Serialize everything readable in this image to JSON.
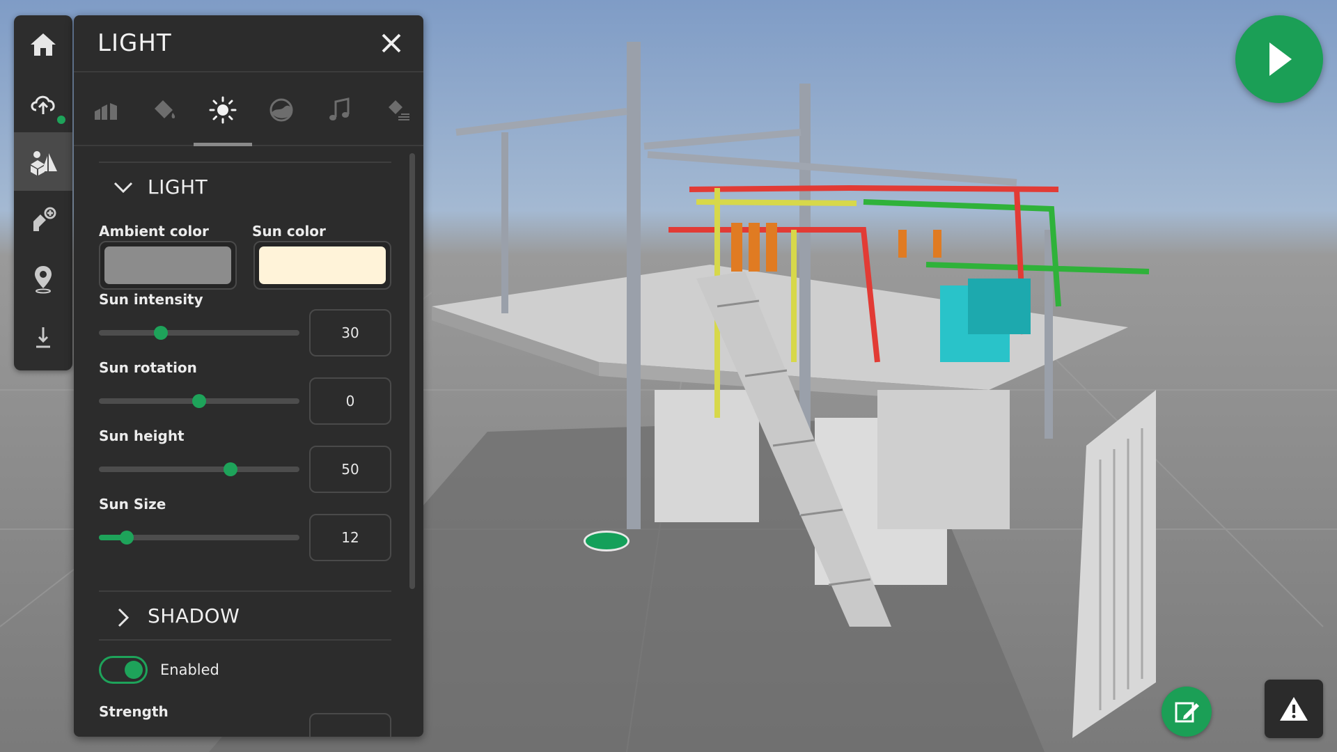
{
  "panel": {
    "title": "LIGHT",
    "tabs": [
      {
        "icon": "buildings-icon"
      },
      {
        "icon": "paint-bucket-icon"
      },
      {
        "icon": "sun-icon",
        "active": true
      },
      {
        "icon": "environment-globe-icon"
      },
      {
        "icon": "music-note-icon"
      },
      {
        "icon": "paint-layers-icon"
      }
    ],
    "light_section": {
      "title": "LIGHT",
      "ambient_color_label": "Ambient color",
      "ambient_color": "#8c8c8c",
      "sun_color_label": "Sun color",
      "sun_color": "#fff3d9",
      "sun_intensity": {
        "label": "Sun intensity",
        "value": "30",
        "fraction": 0.31
      },
      "sun_rotation": {
        "label": "Sun rotation",
        "value": "0",
        "fraction": 0.5
      },
      "sun_height": {
        "label": "Sun height",
        "value": "50",
        "fraction": 0.655
      },
      "sun_size": {
        "label": "Sun Size",
        "value": "12",
        "fraction": 0.14
      }
    },
    "shadow_section": {
      "title": "SHADOW",
      "enabled_label": "Enabled",
      "enabled": true,
      "strength_label": "Strength"
    }
  },
  "toolbar": {
    "items": [
      {
        "icon": "home-icon"
      },
      {
        "icon": "cloud-upload-icon",
        "status": "online"
      },
      {
        "icon": "scene-objects-icon",
        "active": true
      },
      {
        "icon": "add-tool-icon"
      },
      {
        "icon": "location-pin-icon"
      },
      {
        "icon": "download-icon"
      }
    ]
  },
  "colors": {
    "accent": "#1ea35a",
    "panel_bg": "#2c2c2c"
  }
}
